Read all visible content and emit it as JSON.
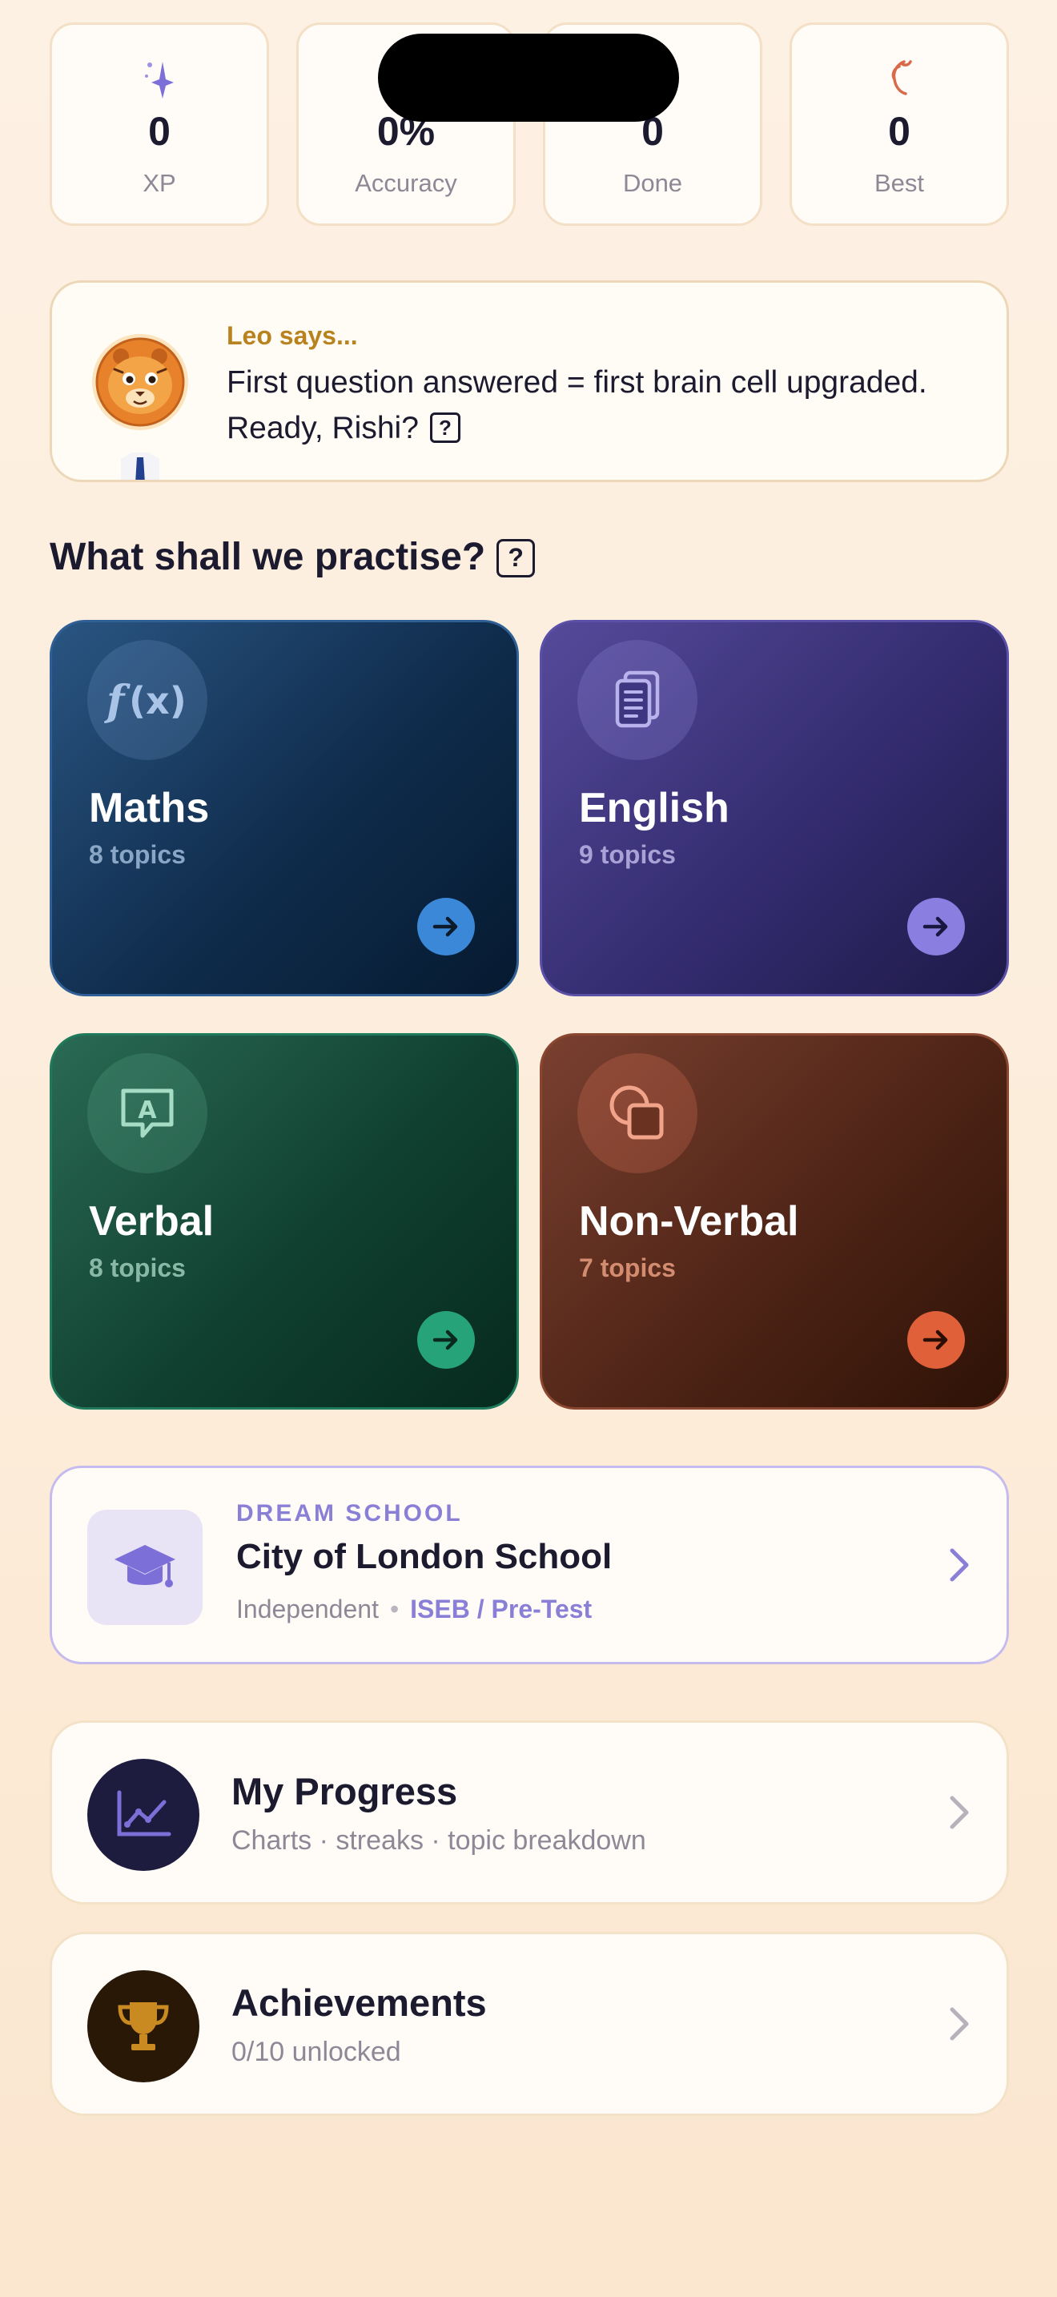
{
  "stats": [
    {
      "icon": "sparkle-icon",
      "value": "0",
      "label": "XP"
    },
    {
      "icon": "target-icon",
      "value": "0%",
      "label": "Accuracy"
    },
    {
      "icon": "check-icon",
      "value": "0",
      "label": "Done"
    },
    {
      "icon": "flame-icon",
      "value": "0",
      "label": "Best"
    }
  ],
  "leo": {
    "title": "Leo says...",
    "message": "First question answered = first brain cell upgraded. Ready, Rishi?",
    "help": "?"
  },
  "practice": {
    "heading": "What shall we practise?",
    "help": "?"
  },
  "subjects": [
    {
      "name": "Maths",
      "topics": "8 topics",
      "icon": "function-icon",
      "accent": "#3b88d8",
      "topics_color": "#8aa6c6"
    },
    {
      "name": "English",
      "topics": "9 topics",
      "icon": "document-icon",
      "accent": "#8a7ee0",
      "topics_color": "#a9a2d6"
    },
    {
      "name": "Verbal",
      "topics": "8 topics",
      "icon": "speech-bubble-icon",
      "accent": "#27a37a",
      "topics_color": "#8ab8a6"
    },
    {
      "name": "Non-Verbal",
      "topics": "7 topics",
      "icon": "shapes-icon",
      "accent": "#e0603a",
      "topics_color": "#d48c70"
    }
  ],
  "dream_school": {
    "kicker": "DREAM SCHOOL",
    "name": "City of London School",
    "type": "Independent",
    "separator": "•",
    "exam": "ISEB / Pre-Test"
  },
  "menu": [
    {
      "title": "My Progress",
      "subtitle": "Charts · streaks · topic breakdown",
      "icon": "chart-icon"
    },
    {
      "title": "Achievements",
      "subtitle": "0/10 unlocked",
      "icon": "trophy-icon"
    }
  ],
  "colors": {
    "background": "#fdf1e4",
    "text": "#1c1a2e",
    "muted": "#8c8896",
    "purple_accent": "#8a7fd6",
    "leo_title": "#b8821e"
  }
}
